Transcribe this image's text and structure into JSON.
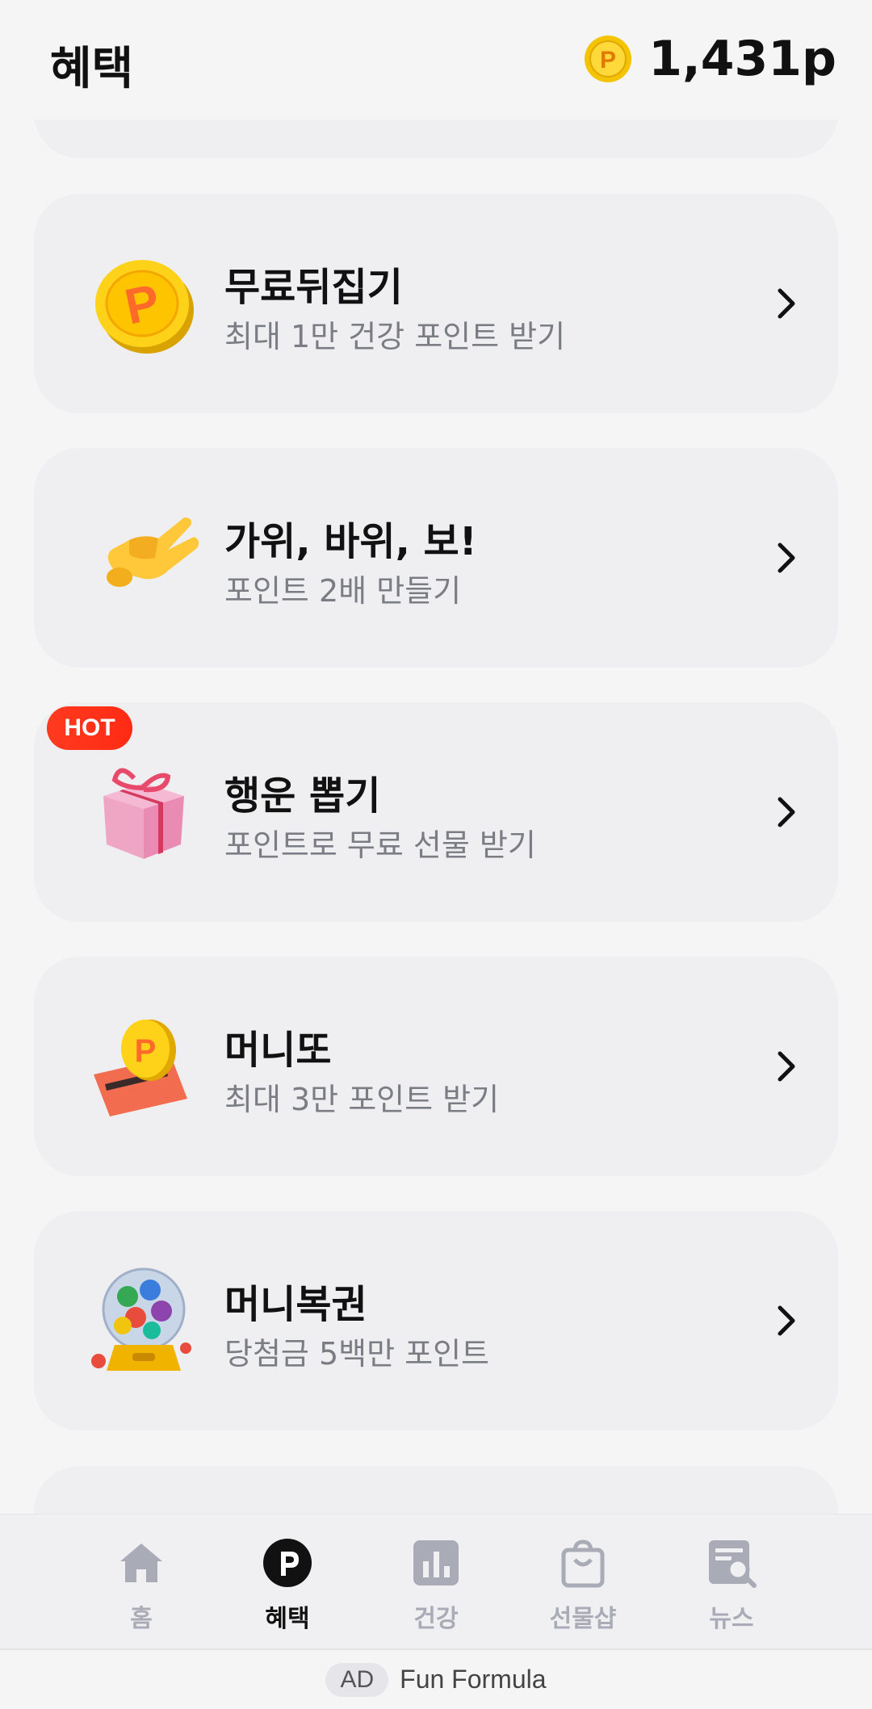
{
  "header": {
    "title": "혜택",
    "points": "1,431p",
    "coin_icon": "p-coin-icon"
  },
  "cards": [
    {
      "title": "무료뒤집기",
      "subtitle": "최대 1만 건강 포인트 받기",
      "icon": "gold-p-coin-icon"
    },
    {
      "title": "가위, 바위, 보!",
      "subtitle": "포인트 2배 만들기",
      "icon": "victory-hand-icon"
    },
    {
      "title": "행운 뽑기",
      "subtitle": "포인트로 무료 선물 받기",
      "icon": "gift-box-icon",
      "badge": "HOT"
    },
    {
      "title": "머니또",
      "subtitle": "최대 3만 포인트 받기",
      "icon": "coin-card-icon"
    },
    {
      "title": "머니복권",
      "subtitle": "당첨금 5백만 포인트",
      "icon": "lottery-machine-icon"
    }
  ],
  "nav": {
    "items": [
      {
        "label": "홈",
        "icon": "home-icon"
      },
      {
        "label": "혜택",
        "icon": "p-circle-icon",
        "active": true
      },
      {
        "label": "건강",
        "icon": "bar-chart-icon"
      },
      {
        "label": "선물샵",
        "icon": "shopping-bag-icon"
      },
      {
        "label": "뉴스",
        "icon": "news-search-icon"
      }
    ]
  },
  "ad": {
    "tag": "AD",
    "text": "Fun Formula"
  },
  "colors": {
    "background": "#f5f5f6",
    "card": "#efeff1",
    "hot_badge": "#ff2a14",
    "subtitle": "#7b7d84",
    "nav_inactive": "#a9acb6"
  }
}
